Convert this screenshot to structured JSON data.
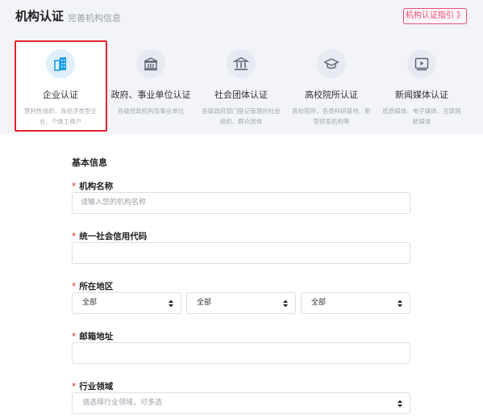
{
  "header": {
    "title": "机构认证",
    "subtitle": "完善机构信息",
    "guide_button": "机构认证指引 》"
  },
  "cards": [
    {
      "label": "企业认证",
      "desc": "营利性组织、各经济类型企业、个体工商户",
      "icon": "building-icon",
      "active": true
    },
    {
      "label": "政府、事业单位认证",
      "desc": "各级党政机构及事业单位",
      "icon": "government-building-icon",
      "active": false
    },
    {
      "label": "社会团体认证",
      "desc": "各级政府部门登记管理的社会组织、群众团体",
      "icon": "institution-pillars-icon",
      "active": false
    },
    {
      "label": "高校院所认证",
      "desc": "高校院所、各类科研基地、新型研发机构等",
      "icon": "graduation-cap-icon",
      "active": false
    },
    {
      "label": "新闻媒体认证",
      "desc": "纸质媒体、电子媒体、互联网新媒体",
      "icon": "media-player-icon",
      "active": false
    }
  ],
  "form": {
    "section_title": "基本信息",
    "required_mark": "*",
    "org_name": {
      "label": "机构名称",
      "placeholder": "请输入您的机构名称",
      "value": ""
    },
    "credit_code": {
      "label": "统一社会信用代码",
      "placeholder": "",
      "value": ""
    },
    "region": {
      "label": "所在地区",
      "province": "全部",
      "city": "全部",
      "district": "全部"
    },
    "address": {
      "label": "邮箱地址",
      "placeholder": "",
      "value": ""
    },
    "industry": {
      "label": "行业领域",
      "placeholder": "请选择行业领域，可多选"
    }
  },
  "colors": {
    "accent_red": "#e3242b",
    "guide_pink": "#e9507a",
    "active_icon": "#1a9ee6",
    "inactive_icon": "#5b6573"
  }
}
